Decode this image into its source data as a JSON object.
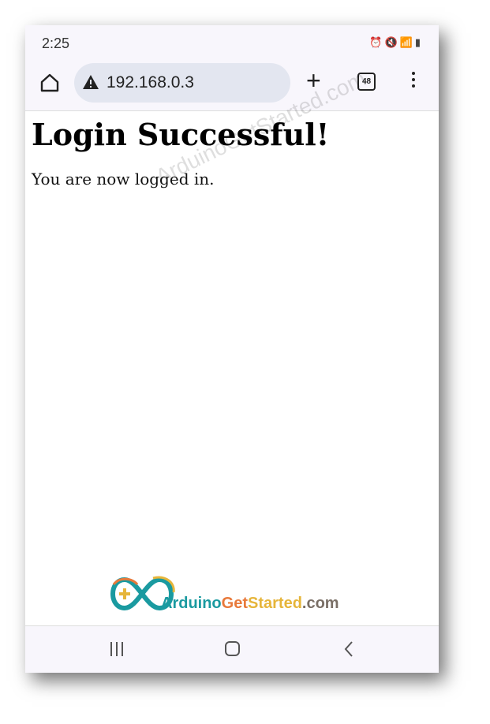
{
  "status_bar": {
    "time": "2:25",
    "icons": [
      "alarm-icon",
      "mute-icon",
      "wifi-icon",
      "signal-icon",
      "battery-icon"
    ]
  },
  "browser": {
    "url": "192.168.0.3",
    "tab_count": "48"
  },
  "page": {
    "heading": "Login Successful!",
    "message": "You are now logged in."
  },
  "watermark": "ArduinoGetStarted.com",
  "logo": {
    "part1": "Arduino",
    "part2": "Get",
    "part3": "Started",
    "part4": ".com",
    "colors": {
      "part1": "#1a9aa0",
      "part2": "#e8793a",
      "part3": "#e6b53a",
      "part4": "#7a6f66"
    }
  }
}
